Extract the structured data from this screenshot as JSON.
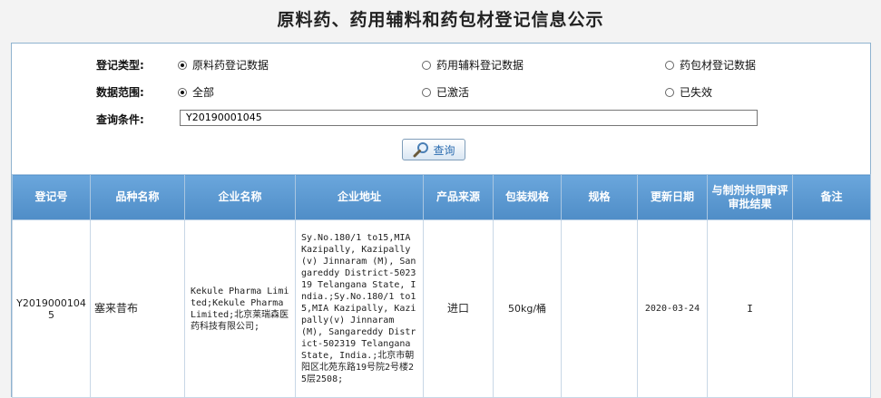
{
  "title": "原料药、药用辅料和药包材登记信息公示",
  "form": {
    "type_label": "登记类型:",
    "type_options": [
      {
        "label": "原料药登记数据",
        "checked": true
      },
      {
        "label": "药用辅料登记数据",
        "checked": false
      },
      {
        "label": "药包材登记数据",
        "checked": false
      }
    ],
    "scope_label": "数据范围:",
    "scope_options": [
      {
        "label": "全部",
        "checked": true
      },
      {
        "label": "已激活",
        "checked": false
      },
      {
        "label": "已失效",
        "checked": false
      }
    ],
    "query_label": "查询条件:",
    "query_value": "Y20190001045",
    "search_label": "查询"
  },
  "table": {
    "headers": [
      "登记号",
      "品种名称",
      "企业名称",
      "企业地址",
      "产品来源",
      "包装规格",
      "规格",
      "更新日期",
      "与制剂共同审评审批结果",
      "备注"
    ],
    "rows": [
      {
        "reg_no": "Y20190001045",
        "product": "塞来昔布",
        "company": "Kekule Pharma Limited;Kekule Pharma Limited;北京莱瑞森医药科技有限公司;",
        "address": "Sy.No.180/1 to15,MIA Kazipally, Kazipally (v) Jinnaram (M), Sangareddy District-502319 Telangana State, India.;Sy.No.180/1 to15,MIA Kazipally, Kazipally(v) Jinnaram (M), Sangareddy District-502319 Telangana State, India.;北京市朝阳区北苑东路19号院2号楼25层2508;",
        "source": "进口",
        "package": "50kg/桶",
        "spec": "",
        "updated": "2020-03-24",
        "review": "I",
        "remark": ""
      }
    ]
  }
}
